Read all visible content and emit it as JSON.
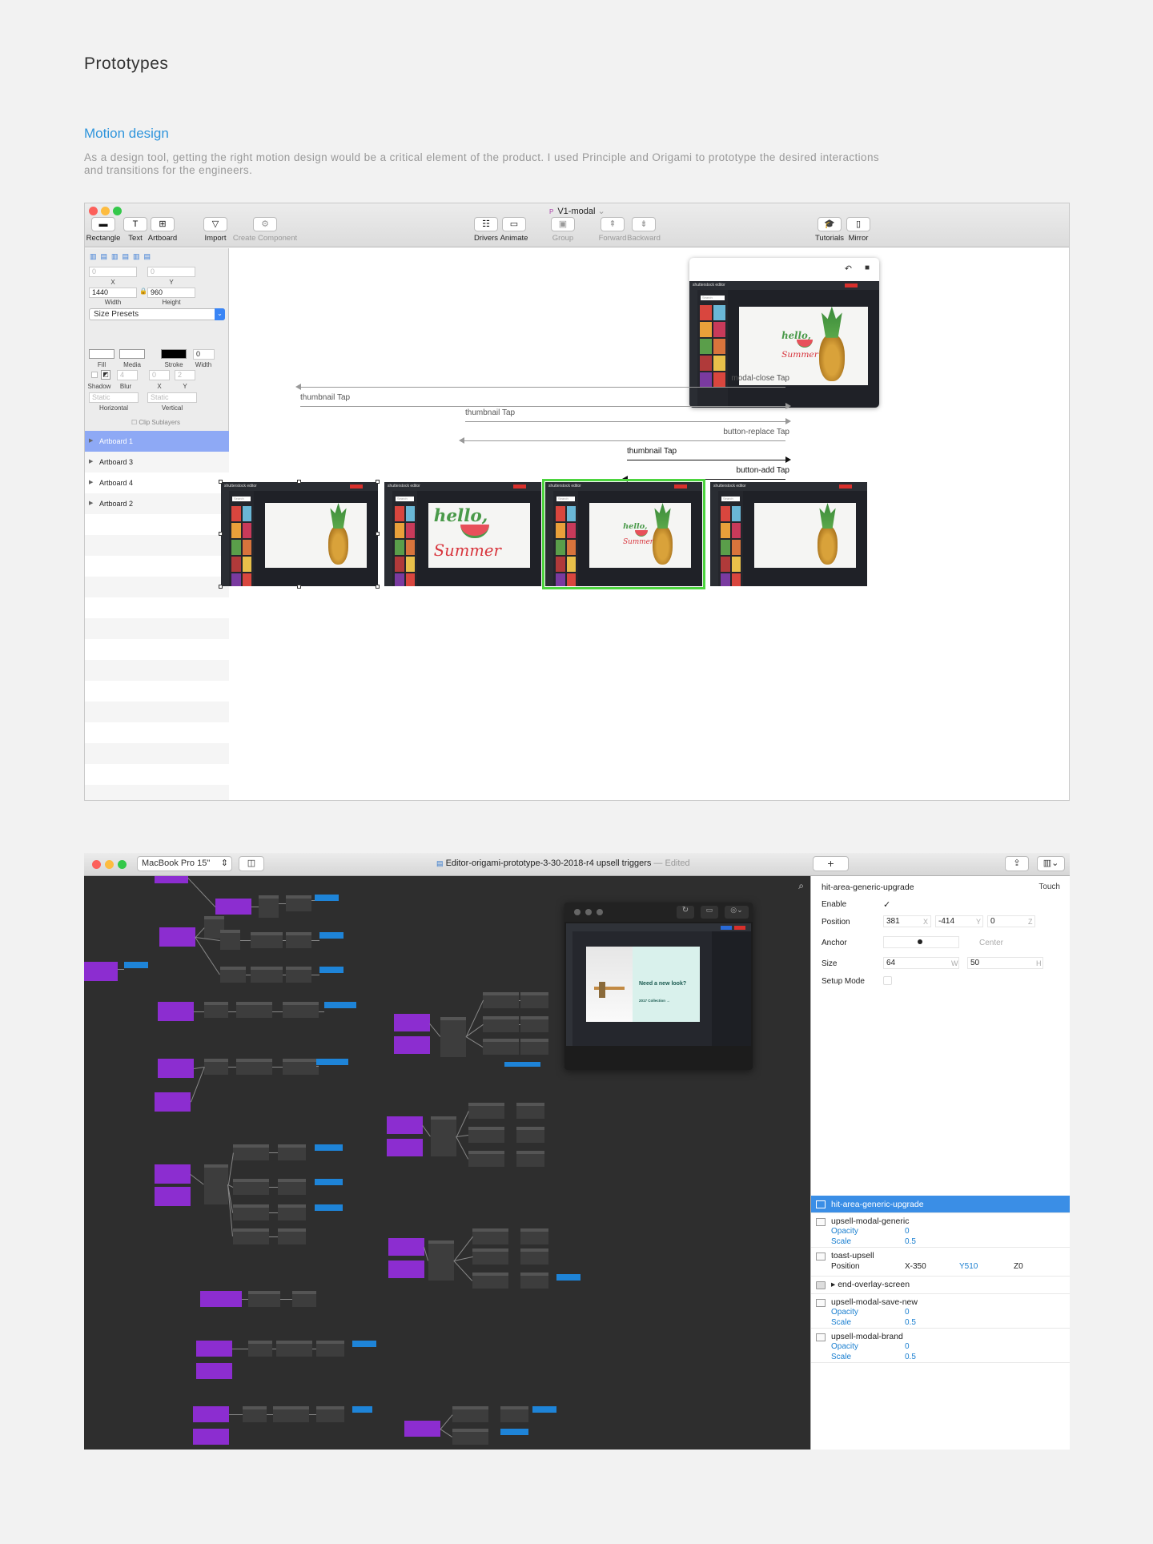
{
  "page": {
    "title": "Prototypes",
    "section_title": "Motion design",
    "description": "As a design tool, getting the right motion design would be a critical element of the product. I used Principle and Origami to prototype the desired interactions and transitions for the engineers."
  },
  "principle": {
    "window_title": "V1-modal",
    "toolbar_left": [
      {
        "label": "Rectangle",
        "icon": "rectangle-icon",
        "glyph": "▬"
      },
      {
        "label": "Text",
        "icon": "text-icon",
        "glyph": "T"
      },
      {
        "label": "Artboard",
        "icon": "artboard-icon",
        "glyph": "⊞"
      },
      {
        "label": "Import",
        "icon": "import-icon",
        "glyph": "▽"
      },
      {
        "label": "Create Component",
        "icon": "component-icon",
        "glyph": "⚙"
      }
    ],
    "toolbar_center": [
      {
        "label": "Drivers",
        "icon": "drivers-icon",
        "glyph": "☷"
      },
      {
        "label": "Animate",
        "icon": "animate-icon",
        "glyph": "▭"
      },
      {
        "label": "Group",
        "icon": "group-icon",
        "glyph": "▣"
      },
      {
        "label": "Forward",
        "icon": "forward-icon",
        "glyph": "⇞"
      },
      {
        "label": "Backward",
        "icon": "backward-icon",
        "glyph": "⇟"
      }
    ],
    "toolbar_right": [
      {
        "label": "Tutorials",
        "icon": "tutorials-icon",
        "glyph": "🎓"
      },
      {
        "label": "Mirror",
        "icon": "mirror-icon",
        "glyph": "▯"
      }
    ],
    "inspector": {
      "x": "0",
      "y": "0",
      "x_label": "X",
      "y_label": "Y",
      "width": "1440",
      "height": "960",
      "width_label": "Width",
      "height_label": "Height",
      "size_presets": "Size Presets",
      "fill_label": "Fill",
      "media_label": "Media",
      "stroke_label": "Stroke",
      "stroke_width": "0",
      "stroke_width_label": "Width",
      "shadow_label": "Shadow",
      "blur": "4",
      "blur_label": "Blur",
      "shadow_x": "0",
      "shadow_y": "2",
      "shadow_x_label": "X",
      "shadow_y_label": "Y",
      "horizontal": "Static",
      "vertical": "Static",
      "horizontal_label": "Horizontal",
      "vertical_label": "Vertical",
      "clip_label": "Clip Sublayers"
    },
    "layers": [
      "Artboard 1",
      "Artboard 3",
      "Artboard 4",
      "Artboard 2"
    ],
    "transitions": [
      "modal-close Tap",
      "thumbnail Tap",
      "thumbnail Tap",
      "button-replace Tap",
      "thumbnail Tap",
      "button-add Tap"
    ],
    "artboard_text": {
      "brand": "shutterstock editor",
      "search": "Search"
    },
    "accent": "#4cd43e",
    "selection": "#8ea9f5"
  },
  "origami": {
    "device": "MacBook Pro 15\"",
    "document_title": "Editor-origami-prototype-3-30-2018-r4 upsell triggers",
    "edited": "— Edited",
    "add_label": "+",
    "preview_card": {
      "headline": "Need a new look?",
      "cta": "2017 Collection →"
    },
    "inspector": {
      "layer_name": "hit-area-generic-upgrade",
      "type": "Touch",
      "enable_label": "Enable",
      "enable_value": "✓",
      "position_label": "Position",
      "pos_x": "381",
      "pos_y": "-414",
      "pos_z": "0",
      "anchor_label": "Anchor",
      "anchor_value": "Center",
      "size_label": "Size",
      "size_w": "64",
      "size_h": "50",
      "setup_label": "Setup Mode",
      "units": [
        "X",
        "Y",
        "Z",
        "W",
        "H"
      ]
    },
    "layers": [
      {
        "name": "hit-area-generic-upgrade",
        "selected": true
      },
      {
        "name": "upsell-modal-generic",
        "props": [
          {
            "k": "Opacity",
            "v": "0"
          },
          {
            "k": "Scale",
            "v": "0.5"
          }
        ]
      },
      {
        "name": "toast-upsell",
        "position": {
          "label": "Position",
          "x": "X-350",
          "y": "Y510",
          "z": "Z0"
        }
      },
      {
        "name": "end-overlay-screen",
        "folder": true
      },
      {
        "name": "upsell-modal-save-new",
        "props": [
          {
            "k": "Opacity",
            "v": "0"
          },
          {
            "k": "Scale",
            "v": "0.5"
          }
        ]
      },
      {
        "name": "upsell-modal-brand",
        "props": [
          {
            "k": "Opacity",
            "v": "0"
          },
          {
            "k": "Scale",
            "v": "0.5"
          }
        ]
      }
    ],
    "node_colors": {
      "purple": "#8c2dd0",
      "blue": "#1e84d8",
      "gray": "#3d3d3d"
    }
  }
}
